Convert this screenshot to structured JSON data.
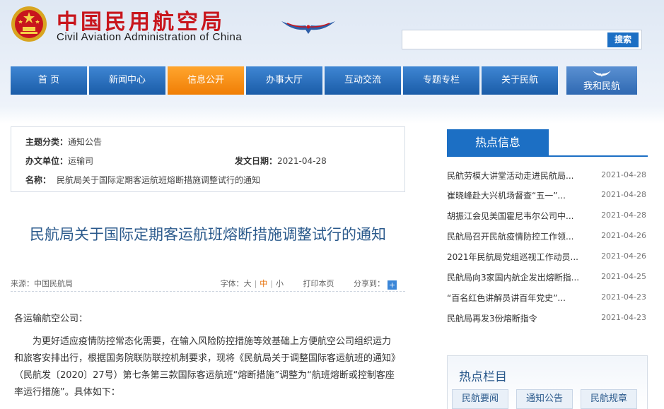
{
  "header": {
    "logo_cn": "中国民用航空局",
    "logo_en": "Civil Aviation Administration of China",
    "search": {
      "placeholder": "",
      "button_label": "搜索"
    }
  },
  "nav": {
    "items": [
      {
        "label": "首 页"
      },
      {
        "label": "新闻中心"
      },
      {
        "label": "信息公开",
        "active": true
      },
      {
        "label": "办事大厅"
      },
      {
        "label": "互动交流"
      },
      {
        "label": "专题专栏"
      },
      {
        "label": "关于民航"
      },
      {
        "label": "我和民航"
      }
    ],
    "colors": {
      "normal": "#1a5ca8",
      "active": "#f07e05"
    }
  },
  "meta": {
    "topic_label": "主题分类：",
    "topic_value": "通知公告",
    "office_label": "办文单位：",
    "office_value": "运输司",
    "date_label": "发文日期：",
    "date_value": "2021-04-28",
    "name_label": "名称：",
    "name_value": "民航局关于国际定期客运航班熔断措施调整试行的通知"
  },
  "article": {
    "title": "民航局关于国际定期客运航班熔断措施调整试行的通知",
    "source": "来源：中国民航局",
    "font_label": "字体：",
    "font_large": "大",
    "font_medium": "中",
    "font_small": "小",
    "print_label": "打印本页",
    "share_label": "分享到：",
    "greeting": "各运输航空公司：",
    "paragraph": "为更好适应疫情防控常态化需要，在输入风险防控措施等效基础上方便航空公司组织运力和旅客安排出行，根据国务院联防联控机制要求，现将《民航局关于调整国际客运航班的通知》（民航发〔2020〕27号）第七条第三款国际客运航班“熔断措施”调整为“航班熔断或控制客座率运行措施”。具体如下："
  },
  "sidebar": {
    "hot_title": "热点信息",
    "news": [
      {
        "title": "民航劳模大讲堂活动走进民航局...",
        "date": "2021-04-28"
      },
      {
        "title": "崔晓峰赴大兴机场督查“五一”...",
        "date": "2021-04-28"
      },
      {
        "title": "胡振江会见美国霍尼韦尔公司中...",
        "date": "2021-04-28"
      },
      {
        "title": "民航局召开民航疫情防控工作领...",
        "date": "2021-04-26"
      },
      {
        "title": "2021年民航局党组巡视工作动员...",
        "date": "2021-04-26"
      },
      {
        "title": "民航局向3家国内航企发出熔断指...",
        "date": "2021-04-25"
      },
      {
        "title": "“百名红色讲解员讲百年党史”...",
        "date": "2021-04-23"
      },
      {
        "title": "民航局再发3份熔断指令",
        "date": "2021-04-23"
      }
    ],
    "columns_title": "热点栏目",
    "columns": [
      {
        "label": "民航要闻"
      },
      {
        "label": "通知公告"
      },
      {
        "label": "民航规章"
      }
    ]
  }
}
